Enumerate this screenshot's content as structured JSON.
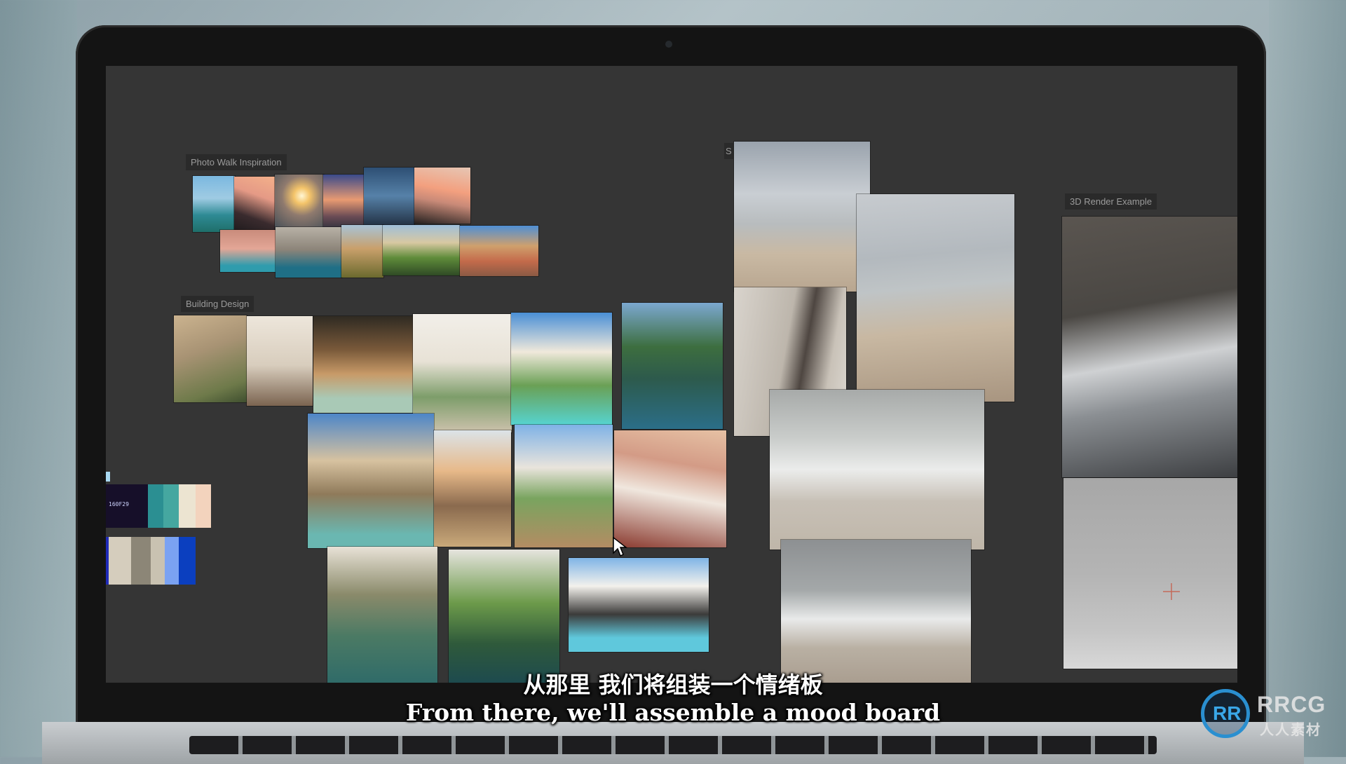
{
  "boards": {
    "photo_walk_label": "Photo Walk Inspiration",
    "building_label": "Building Design",
    "beach_label": "S",
    "render_label": "3D Render Example"
  },
  "palette": {
    "hex_label": "160F29",
    "top_swatches": [
      "#160f29",
      "#2b8f92",
      "#45a7a0",
      "#ece4d1",
      "#f3d3bd"
    ],
    "bottom_swatches": [
      "#1f2bb8",
      "#d5cdbd",
      "#8c8677",
      "#c9c2b1",
      "#7aa2f2",
      "#0b3fbf"
    ]
  },
  "subtitles": {
    "chinese": "从那里 我们将组装一个情绪板",
    "english": "From there, we'll assemble a mood board"
  },
  "watermark": {
    "logo_letters": "RR",
    "brand": "RRCG",
    "brand_cn": "人人素材"
  }
}
